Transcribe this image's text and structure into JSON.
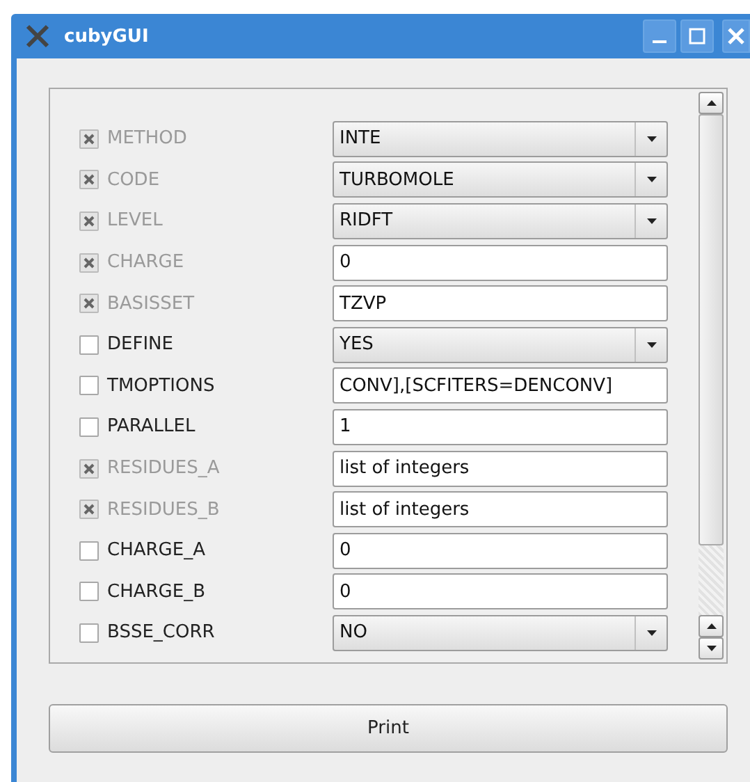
{
  "window": {
    "title": "cubyGUI"
  },
  "options": [
    {
      "label": "METHOD",
      "checked": true,
      "disabled": true,
      "kind": "combo",
      "value": "INTE"
    },
    {
      "label": "CODE",
      "checked": true,
      "disabled": true,
      "kind": "combo",
      "value": "TURBOMOLE"
    },
    {
      "label": "LEVEL",
      "checked": true,
      "disabled": true,
      "kind": "combo",
      "value": "RIDFT"
    },
    {
      "label": "CHARGE",
      "checked": true,
      "disabled": true,
      "kind": "text",
      "value": "0"
    },
    {
      "label": "BASISSET",
      "checked": true,
      "disabled": true,
      "kind": "text",
      "value": "TZVP"
    },
    {
      "label": "DEFINE",
      "checked": false,
      "disabled": false,
      "kind": "combo",
      "value": "YES"
    },
    {
      "label": "TMOPTIONS",
      "checked": false,
      "disabled": false,
      "kind": "text",
      "value": "CONV],[SCFITERS=DENCONV]"
    },
    {
      "label": "PARALLEL",
      "checked": false,
      "disabled": false,
      "kind": "text",
      "value": "1"
    },
    {
      "label": "RESIDUES_A",
      "checked": true,
      "disabled": true,
      "kind": "text",
      "value": "list of integers"
    },
    {
      "label": "RESIDUES_B",
      "checked": true,
      "disabled": true,
      "kind": "text",
      "value": "list of integers"
    },
    {
      "label": "CHARGE_A",
      "checked": false,
      "disabled": false,
      "kind": "text",
      "value": "0"
    },
    {
      "label": "CHARGE_B",
      "checked": false,
      "disabled": false,
      "kind": "text",
      "value": "0"
    },
    {
      "label": "BSSE_CORR",
      "checked": false,
      "disabled": false,
      "kind": "combo",
      "value": "NO"
    }
  ],
  "print_button": "Print"
}
